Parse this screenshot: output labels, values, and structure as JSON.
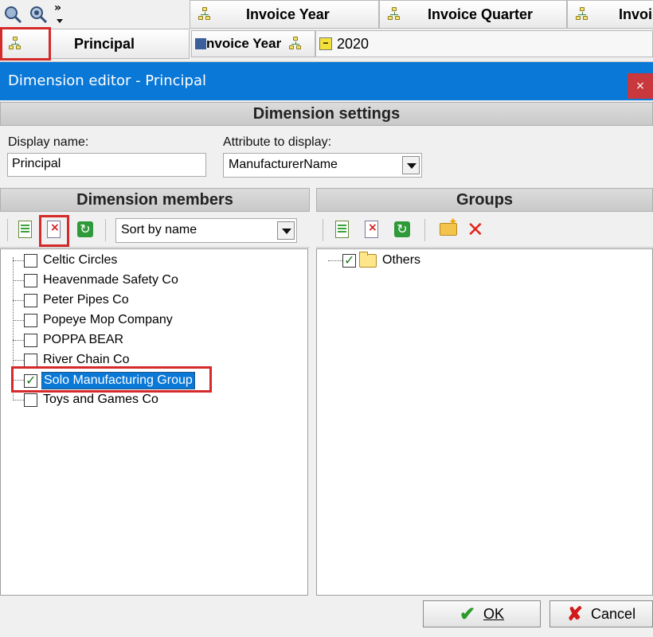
{
  "pivot": {
    "collapse_label": "»",
    "headers": [
      "Invoice Year",
      "Invoice Quarter",
      "Invoi"
    ],
    "row_header": "Principal",
    "sub_field": "nvoice Year",
    "year_value": "2020",
    "expand_symbol": "−"
  },
  "dialog": {
    "title": "Dimension editor  -  Principal",
    "close_label": "×",
    "settings_header": "Dimension settings",
    "display_name_label": "Display name:",
    "display_name_value": "Principal",
    "attribute_label": "Attribute to display:",
    "attribute_value": "ManufacturerName",
    "members_header": "Dimension members",
    "groups_header": "Groups",
    "sort_value": "Sort by name",
    "members": [
      {
        "label": "Celtic Circles",
        "checked": false
      },
      {
        "label": "Heavenmade Safety Co",
        "checked": false
      },
      {
        "label": "Peter Pipes Co",
        "checked": false
      },
      {
        "label": "Popeye Mop Company",
        "checked": false
      },
      {
        "label": "POPPA BEAR",
        "checked": false
      },
      {
        "label": "River Chain Co",
        "checked": false
      },
      {
        "label": "Solo Manufacturing Group",
        "checked": true,
        "selected": true
      },
      {
        "label": "Toys and Games Co",
        "checked": false
      }
    ],
    "groups": [
      {
        "label": "Others",
        "checked": true
      }
    ],
    "ok_label": "OK",
    "cancel_label": "Cancel"
  },
  "colors": {
    "titlebar": "#0a78d7",
    "highlight_box": "#d42a2a",
    "selection": "#0a78d7"
  },
  "icons": [
    "magnifier-icon",
    "settings-magnifier-icon",
    "hierarchy-icon",
    "new-doc-icon",
    "delete-doc-icon",
    "refresh-icon",
    "new-folder-icon",
    "delete-icon",
    "check-icon",
    "cancel-x-icon"
  ]
}
